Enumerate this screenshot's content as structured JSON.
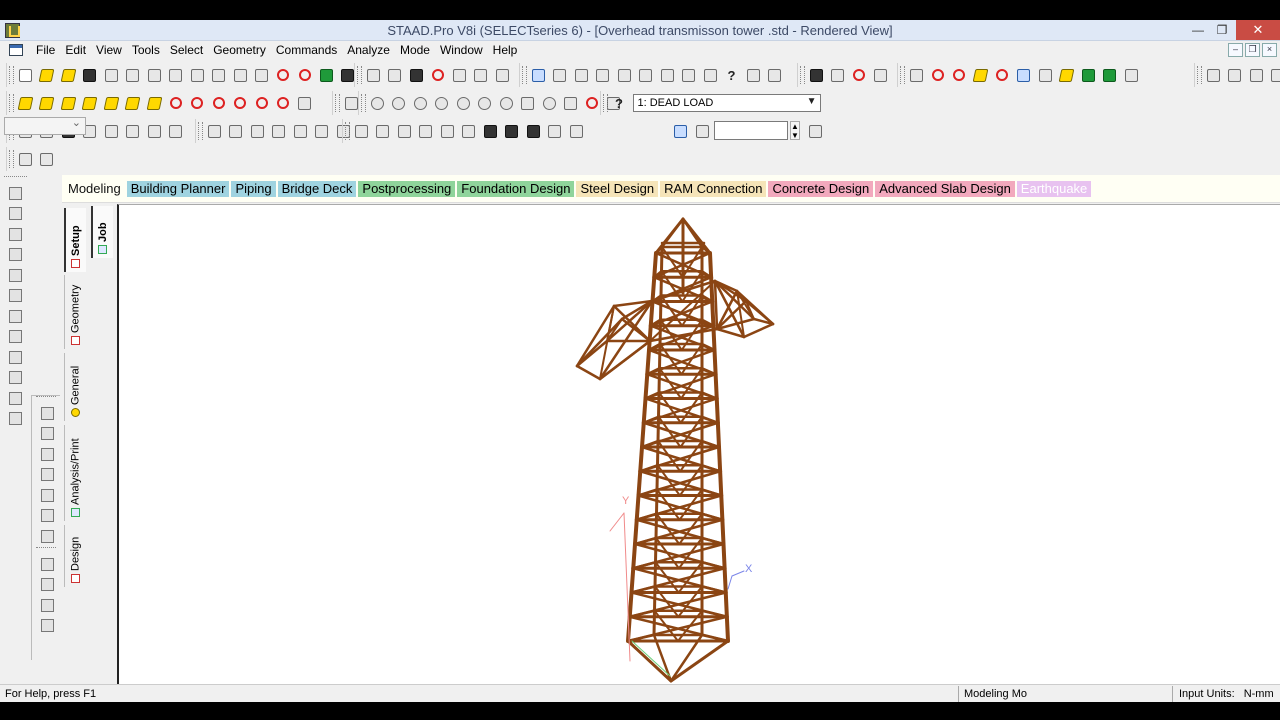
{
  "window": {
    "title": "STAAD.Pro V8i (SELECTseries 6) - [Overhead transmisson tower .std - Rendered View]",
    "minimize_label": "—",
    "restore_label": "❐",
    "close_label": "✕"
  },
  "menu": {
    "items": [
      "File",
      "Edit",
      "View",
      "Tools",
      "Select",
      "Geometry",
      "Commands",
      "Analyze",
      "Mode",
      "Window",
      "Help"
    ]
  },
  "toolbar": {
    "load_case": "1: DEAD LOAD",
    "help_glyph": "?"
  },
  "ribbon": {
    "tabs": [
      {
        "label": "Modeling",
        "color": "#fffff4"
      },
      {
        "label": "Building Planner",
        "color": "#9fd3e0"
      },
      {
        "label": "Piping",
        "color": "#9fd3e0"
      },
      {
        "label": "Bridge Deck",
        "color": "#9fd3e0"
      },
      {
        "label": "Postprocessing",
        "color": "#8fd49b"
      },
      {
        "label": "Foundation Design",
        "color": "#8fd49b"
      },
      {
        "label": "Steel Design",
        "color": "#f5e4b8"
      },
      {
        "label": "RAM Connection",
        "color": "#f5e4b8"
      },
      {
        "label": "Concrete Design",
        "color": "#f2a9bd"
      },
      {
        "label": "Advanced Slab Design",
        "color": "#f2a9bd"
      },
      {
        "label": "Earthquake",
        "color": "#e8c2f0"
      }
    ]
  },
  "side_tabs": {
    "setup": "Setup",
    "geometry": "Geometry",
    "general": "General",
    "analysis_print": "Analysis/Print",
    "design": "Design",
    "job": "Job"
  },
  "viewport": {
    "axis_x": "X",
    "axis_y": "Y",
    "member_color": "#8b4513"
  },
  "status": {
    "help": "For Help, press F1",
    "mode": "Modeling Mo",
    "units_label": "Input Units:",
    "units_value": "N-mm"
  }
}
